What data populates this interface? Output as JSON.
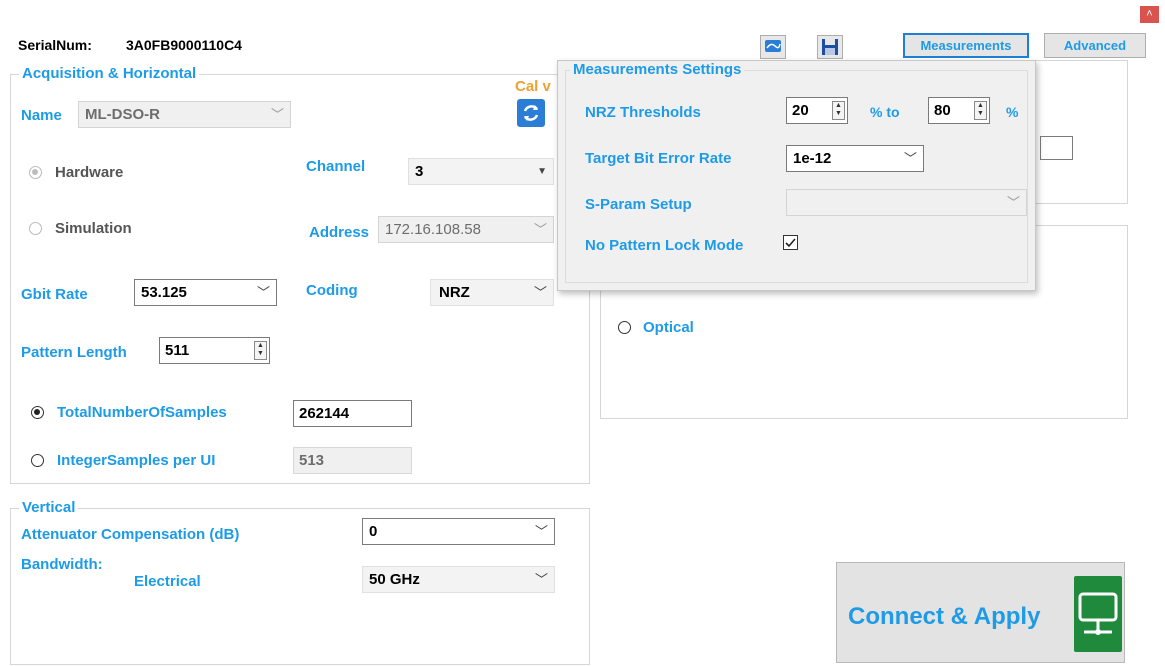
{
  "header": {
    "serial_label": "SerialNum:",
    "serial_value": "3A0FB9000110C4",
    "cal_label": "Cal v",
    "measurements_btn": "Measurements",
    "advanced_btn": "Advanced",
    "close_glyph": "˄"
  },
  "acquisition": {
    "legend": "Acquisition & Horizontal",
    "name_label": "Name",
    "name_value": "ML-DSO-R",
    "hardware_label": "Hardware",
    "simulation_label": "Simulation",
    "channel_label": "Channel",
    "channel_value": "3",
    "address_label": "Address",
    "address_value": "172.16.108.58",
    "gbit_label": "Gbit Rate",
    "gbit_value": "53.125",
    "coding_label": "Coding",
    "coding_value": "NRZ",
    "pattern_label": "Pattern Length",
    "pattern_value": "511",
    "total_samples_label": "TotalNumberOfSamples",
    "total_samples_value": "262144",
    "int_samples_label": "IntegerSamples per UI",
    "int_samples_value": "513"
  },
  "vertical": {
    "legend": "Vertical",
    "atten_label": "Attenuator Compensation (dB)",
    "atten_value": "0",
    "bandwidth_label": "Bandwidth:",
    "electrical_label": "Electrical",
    "bandwidth_value": "50 GHz"
  },
  "right": {
    "optical_label": "Optical",
    "connect_label": "Connect & Apply"
  },
  "popup": {
    "legend": "Measurements Settings",
    "nrz_label": "NRZ Thresholds",
    "nrz_low": "20",
    "to_label": "% to",
    "nrz_high": "80",
    "pct_label": "%",
    "ber_label": "Target Bit Error Rate",
    "ber_value": "1e-12",
    "sparam_label": "S-Param Setup",
    "sparam_value": "",
    "nolock_label": "No Pattern Lock Mode",
    "nolock_checked": true
  },
  "colors": {
    "accent": "#1e9be6",
    "connect_icon_bg": "#1f8a3c"
  }
}
